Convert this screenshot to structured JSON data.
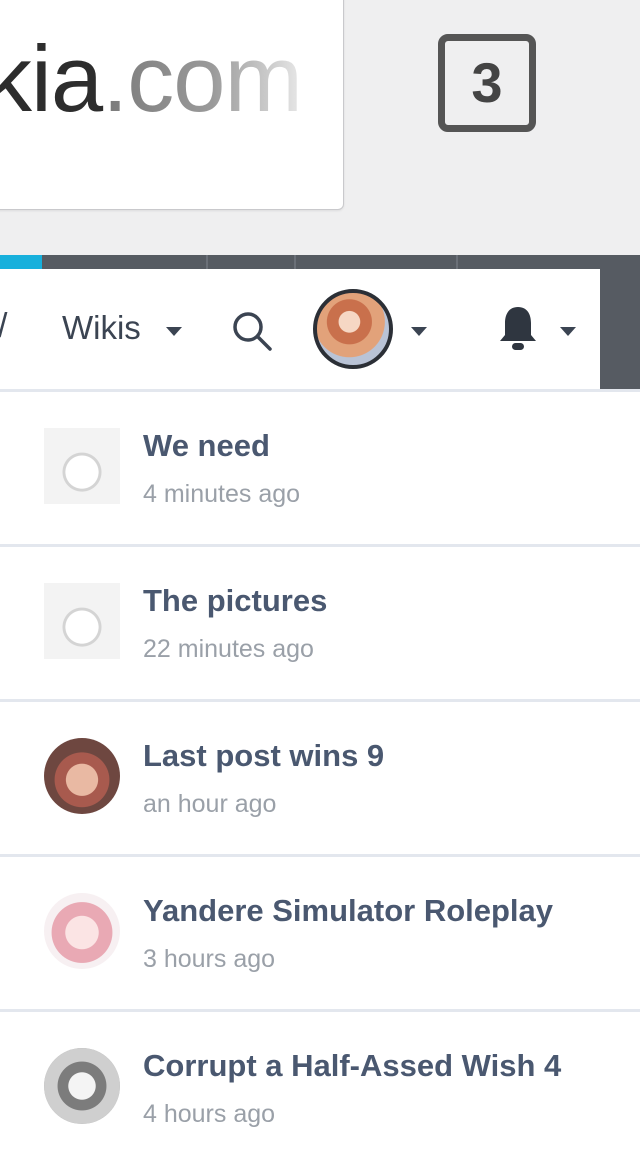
{
  "browser": {
    "url_domain": "kia",
    "url_tld": ".com",
    "tab_count": "3"
  },
  "nav": {
    "partial_item": "/",
    "wikis_label": "Wikis"
  },
  "feed": [
    {
      "title": "We need",
      "time": "4 minutes ago",
      "avatar": "sketch-avatar"
    },
    {
      "title": "The pictures",
      "time": "22 minutes ago",
      "avatar": "sketch-avatar"
    },
    {
      "title": "Last post wins 9",
      "time": "an hour ago",
      "avatar": "photo-avatar"
    },
    {
      "title": "Yandere Simulator Roleplay",
      "time": "3 hours ago",
      "avatar": "anime-avatar"
    },
    {
      "title": "Corrupt a Half-Assed Wish 4",
      "time": "4 hours ago",
      "avatar": "manga-avatar"
    }
  ],
  "colors": {
    "accent": "#17b0dc",
    "topbar": "#565b62",
    "title": "#4a5870",
    "meta": "#9aa0a8"
  }
}
